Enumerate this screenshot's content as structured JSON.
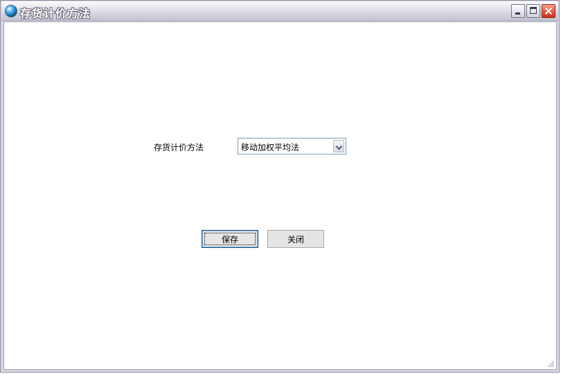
{
  "window": {
    "title": "存货计价方法",
    "icon": "globe-icon",
    "controls": {
      "minimize": "minimize-icon",
      "maximize": "maximize-icon",
      "close": "close-icon"
    }
  },
  "form": {
    "method_label": "存货计价方法",
    "method_value": "移动加权平均法"
  },
  "buttons": {
    "save_label": "保存",
    "close_label": "关闭"
  },
  "colors": {
    "titlebar": "#d2d2de",
    "title_text": "#ffffff",
    "close_button": "#e8604a",
    "focus_border": "#1c5180",
    "client_bg": "#ffffff"
  }
}
